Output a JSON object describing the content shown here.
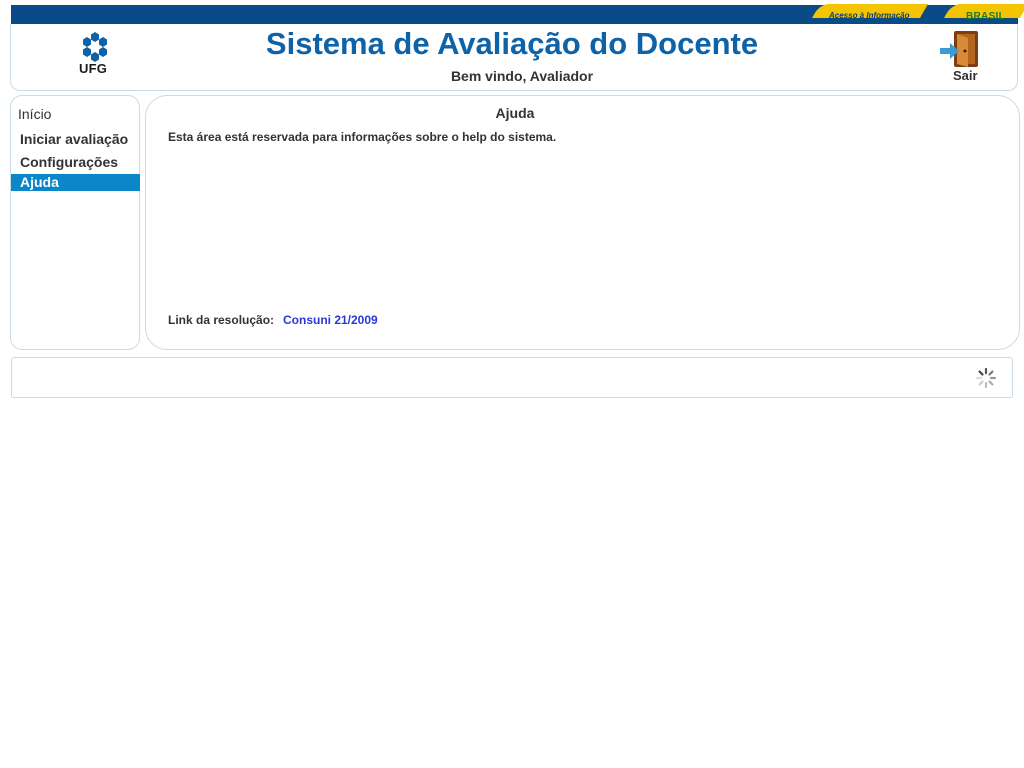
{
  "govbar": {
    "acesso_label": "Acesso à Informação",
    "brasil_label": "BRASIL"
  },
  "header": {
    "logo_text": "UFG",
    "title": "Sistema de Avaliação do Docente",
    "welcome": "Bem vindo, Avaliador",
    "logout_label": "Sair"
  },
  "sidebar": {
    "title": "Início",
    "items": [
      {
        "label": "Iniciar avaliação",
        "active": false
      },
      {
        "label": "Configurações",
        "active": false
      },
      {
        "label": "Ajuda",
        "active": true
      }
    ]
  },
  "main": {
    "title": "Ajuda",
    "text": "Esta área está reservada para informações sobre o help do sistema.",
    "link_label": "Link da resolução:",
    "link_text": "Consuni 21/2009"
  },
  "colors": {
    "gov_blue": "#0a4a86",
    "gov_yellow": "#f5c400",
    "title_blue": "#0e62a8",
    "active_blue": "#0b86c8",
    "link_blue": "#2a38d8"
  },
  "icons": {
    "logo": "ufg-logo-icon",
    "logout": "door-exit-icon",
    "loading": "spinner-icon"
  }
}
